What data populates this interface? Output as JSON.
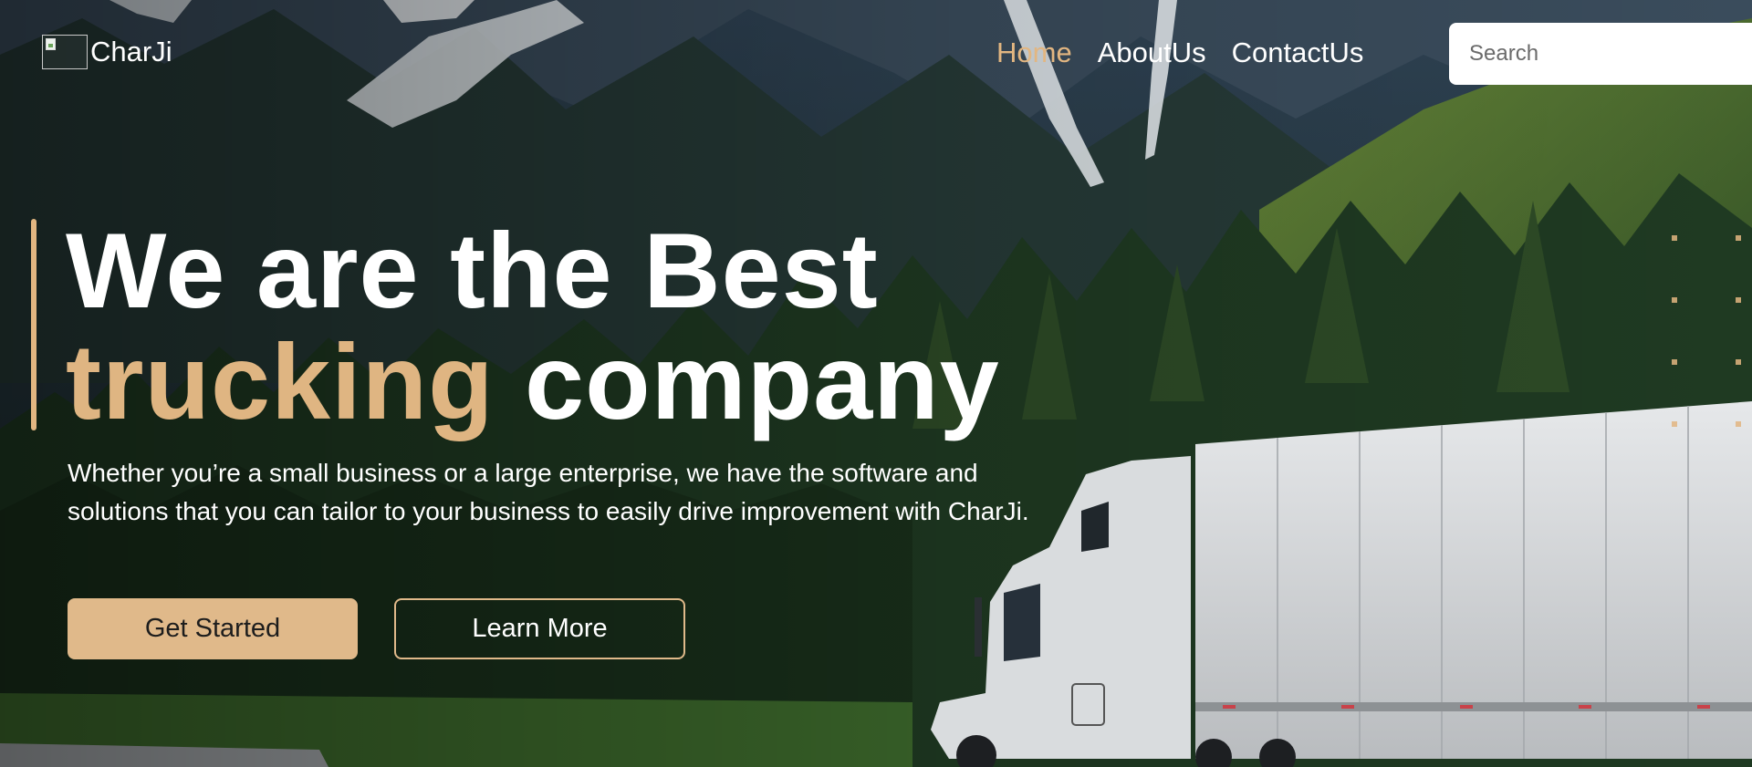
{
  "brand": {
    "name": "CharJi",
    "logo_icon": "broken-image-icon"
  },
  "nav": {
    "links": [
      {
        "label": "Home",
        "active": true
      },
      {
        "label": "AboutUs",
        "active": false
      },
      {
        "label": "ContactUs",
        "active": false
      }
    ]
  },
  "search": {
    "placeholder": "Search",
    "value": ""
  },
  "hero": {
    "headline_part1": "We are the Best",
    "headline_highlight": "trucking",
    "headline_part2": " company",
    "description": "Whether you’re a small business or a large enterprise, we have the software and solutions that you can tailor to your business to easily drive improvement with CharJi.",
    "primary_button": "Get Started",
    "secondary_button": "Learn More"
  },
  "colors": {
    "accent": "#e2b681",
    "primary_button_bg": "#e0b98a",
    "text": "#ffffff"
  }
}
